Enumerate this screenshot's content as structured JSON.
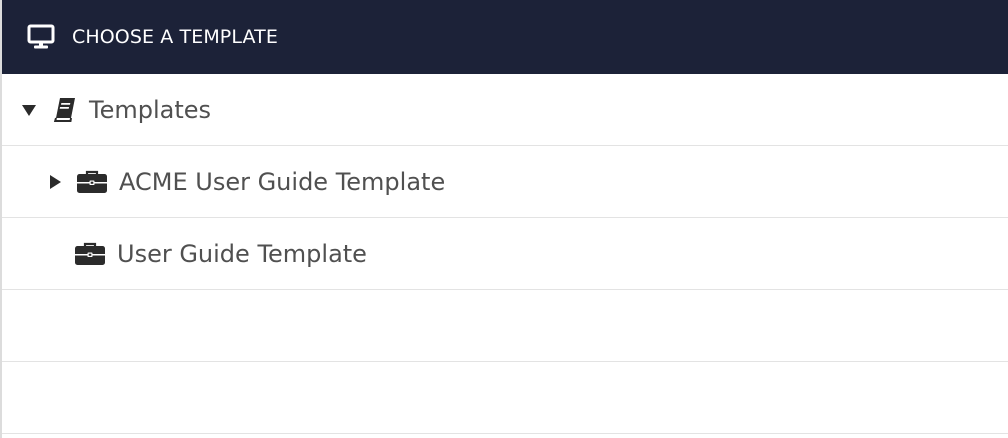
{
  "header": {
    "title": "CHOOSE A TEMPLATE",
    "icon": "monitor-icon"
  },
  "tree": {
    "root": {
      "label": "Templates",
      "expanded": true,
      "toggle_icon": "caret-down-icon",
      "icon": "book-icon"
    },
    "items": [
      {
        "label": "ACME User Guide Template",
        "has_children": true,
        "toggle_icon": "caret-right-icon",
        "icon": "briefcase-icon"
      },
      {
        "label": "User Guide Template",
        "has_children": false,
        "icon": "briefcase-icon"
      }
    ]
  },
  "colors": {
    "header_bg": "#1c2238",
    "header_text": "#ffffff",
    "row_text": "#505050",
    "icon": "#2b2b2b",
    "divider": "#e3e3e3"
  }
}
